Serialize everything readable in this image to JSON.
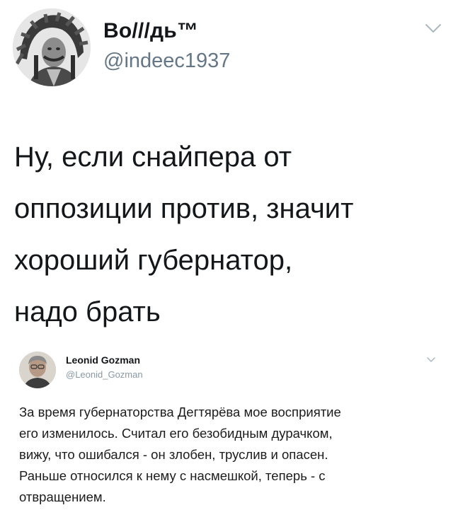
{
  "main_tweet": {
    "display_name": "Во///дь™",
    "handle": "@indeec1937",
    "text_lines": [
      "Ну, если снайпера от",
      "оппозиции против, значит",
      "хороший губернатор,",
      "надо брать"
    ]
  },
  "quoted_tweet": {
    "display_name": "Leonid Gozman",
    "handle": "@Leonid_Gozman",
    "text_lines": [
      "За время губернаторства Дегтярёва мое восприятие",
      "его изменилось. Считал его безобидным дурачком,",
      "вижу, что ошибался - он злобен, труслив и опасен.",
      "Раньше относился к нему с насмешкой, теперь - с",
      "отвращением."
    ]
  },
  "icons": {
    "menu": "chevron-down-icon",
    "avatar_main": "portrait-headdress-avatar",
    "avatar_quote": "portrait-avatar"
  },
  "colors": {
    "text": "#14171a",
    "secondary": "#657786",
    "chevron": "#aab8c2"
  }
}
